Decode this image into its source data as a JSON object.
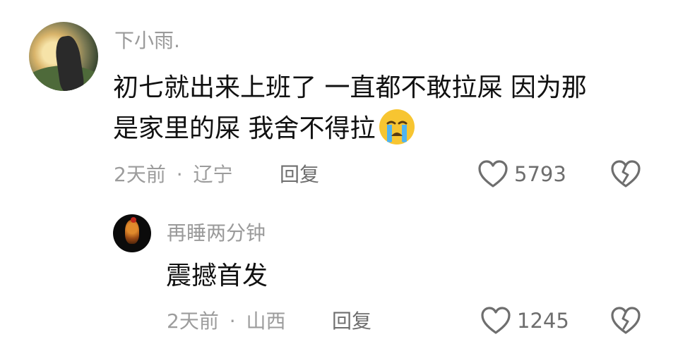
{
  "comments": [
    {
      "username": "下小雨.",
      "text_line1": "初七就出来上班了 一直都不敢拉屎 因为那",
      "text_line2": "是家里的屎 我舍不得拉",
      "emoji": "loudly-crying-face",
      "time": "2天前",
      "separator": "·",
      "location": "辽宁",
      "reply_label": "回复",
      "likes": "5793",
      "avatar": "person-at-sunset"
    },
    {
      "username": "再睡两分钟",
      "text": "震撼首发",
      "time": "2天前",
      "separator": "·",
      "location": "山西",
      "reply_label": "回复",
      "likes": "1245",
      "avatar": "rooster"
    }
  ],
  "icons": {
    "like": "heart-outline-icon",
    "dislike": "broken-heart-icon"
  },
  "colors": {
    "username": "#9a9a9a",
    "text": "#111111",
    "meta": "#9c9c9c",
    "icon": "#6e6e6e"
  }
}
